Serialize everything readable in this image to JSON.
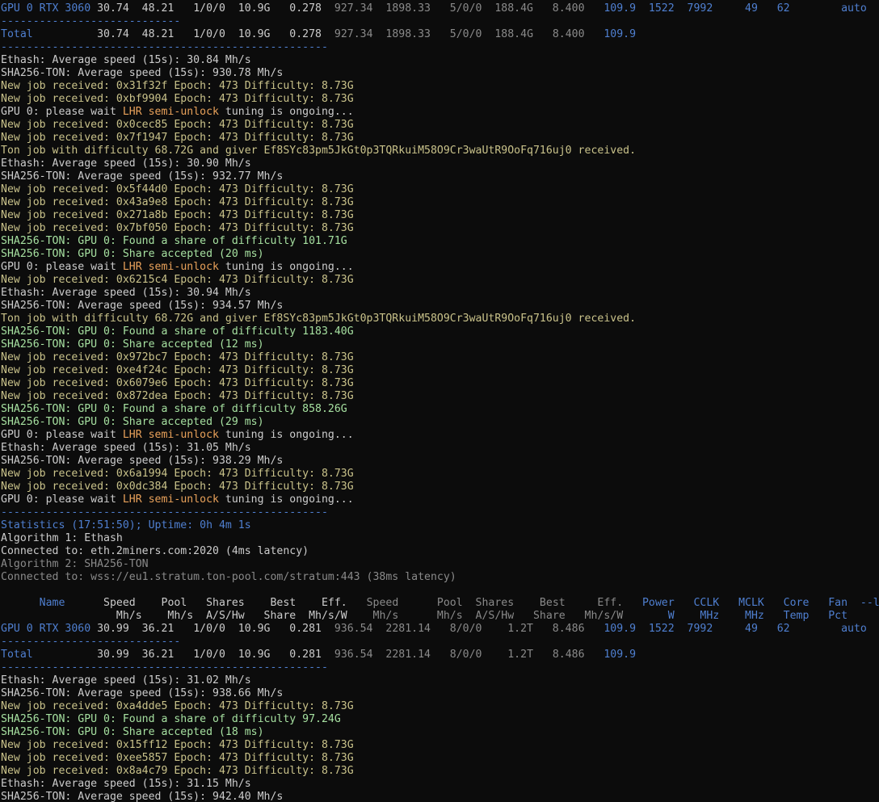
{
  "colors": {
    "background": "#0c0c0c",
    "white": "#cccccc",
    "blue": "#4f7fd0",
    "green": "#a6e0a0",
    "yellow": "#c9c28a",
    "orange": "#e8a15a",
    "gray": "#8a8a8a"
  },
  "lines": [
    [
      [
        "b",
        "GPU 0 RTX 3060"
      ],
      [
        "w",
        " 30.74  48.21   1/0/0  10.9G   0.278 "
      ],
      [
        "gr",
        " 927.34  1898.33   5/0/0  188.4G   8.400 "
      ],
      [
        "b",
        "  109.9  1522  7992     49   62        auto"
      ]
    ],
    [
      [
        "b",
        "----------------------------"
      ]
    ],
    [
      [
        "b",
        "Total"
      ],
      [
        "w",
        "          30.74  48.21   1/0/0  10.9G   0.278 "
      ],
      [
        "gr",
        " 927.34  1898.33   5/0/0  188.4G   8.400 "
      ],
      [
        "b",
        "  109.9"
      ]
    ],
    [
      [
        "b",
        "---------------------------------------------------"
      ]
    ],
    [
      [
        "w",
        "Ethash: Average speed (15s): 30.84 Mh/s"
      ]
    ],
    [
      [
        "w",
        "SHA256-TON: Average speed (15s): 930.78 Mh/s"
      ]
    ],
    [
      [
        "y",
        "New job received: 0x31f32f Epoch: 473 Difficulty: 8.73G"
      ]
    ],
    [
      [
        "y",
        "New job received: 0xbf9904 Epoch: 473 Difficulty: 8.73G"
      ]
    ],
    [
      [
        "w",
        "GPU 0: please wait "
      ],
      [
        "o",
        "LHR semi-unlock"
      ],
      [
        "w",
        " tuning is ongoing..."
      ]
    ],
    [
      [
        "y",
        "New job received: 0x0cec85 Epoch: 473 Difficulty: 8.73G"
      ]
    ],
    [
      [
        "y",
        "New job received: 0x7f1947 Epoch: 473 Difficulty: 8.73G"
      ]
    ],
    [
      [
        "y",
        "Ton job with difficulty 68.72G and giver Ef8SYc83pm5JkGt0p3TQRkuiM58O9Cr3waUtR9OoFq716uj0 received."
      ]
    ],
    [
      [
        "w",
        "Ethash: Average speed (15s): 30.90 Mh/s"
      ]
    ],
    [
      [
        "w",
        "SHA256-TON: Average speed (15s): 932.77 Mh/s"
      ]
    ],
    [
      [
        "y",
        "New job received: 0x5f44d0 Epoch: 473 Difficulty: 8.73G"
      ]
    ],
    [
      [
        "y",
        "New job received: 0x43a9e8 Epoch: 473 Difficulty: 8.73G"
      ]
    ],
    [
      [
        "y",
        "New job received: 0x271a8b Epoch: 473 Difficulty: 8.73G"
      ]
    ],
    [
      [
        "y",
        "New job received: 0x7bf050 Epoch: 473 Difficulty: 8.73G"
      ]
    ],
    [
      [
        "g",
        "SHA256-TON: GPU 0: Found a share of difficulty 101.71G"
      ]
    ],
    [
      [
        "g",
        "SHA256-TON: GPU 0: Share accepted (20 ms)"
      ]
    ],
    [
      [
        "w",
        "GPU 0: please wait "
      ],
      [
        "o",
        "LHR semi-unlock"
      ],
      [
        "w",
        " tuning is ongoing..."
      ]
    ],
    [
      [
        "y",
        "New job received: 0x6215c4 Epoch: 473 Difficulty: 8.73G"
      ]
    ],
    [
      [
        "w",
        "Ethash: Average speed (15s): 30.94 Mh/s"
      ]
    ],
    [
      [
        "w",
        "SHA256-TON: Average speed (15s): 934.57 Mh/s"
      ]
    ],
    [
      [
        "y",
        "Ton job with difficulty 68.72G and giver Ef8SYc83pm5JkGt0p3TQRkuiM58O9Cr3waUtR9OoFq716uj0 received."
      ]
    ],
    [
      [
        "g",
        "SHA256-TON: GPU 0: Found a share of difficulty 1183.40G"
      ]
    ],
    [
      [
        "g",
        "SHA256-TON: GPU 0: Share accepted (12 ms)"
      ]
    ],
    [
      [
        "y",
        "New job received: 0x972bc7 Epoch: 473 Difficulty: 8.73G"
      ]
    ],
    [
      [
        "y",
        "New job received: 0xe4f24c Epoch: 473 Difficulty: 8.73G"
      ]
    ],
    [
      [
        "y",
        "New job received: 0x6079e6 Epoch: 473 Difficulty: 8.73G"
      ]
    ],
    [
      [
        "y",
        "New job received: 0x872dea Epoch: 473 Difficulty: 8.73G"
      ]
    ],
    [
      [
        "g",
        "SHA256-TON: GPU 0: Found a share of difficulty 858.26G"
      ]
    ],
    [
      [
        "g",
        "SHA256-TON: GPU 0: Share accepted (29 ms)"
      ]
    ],
    [
      [
        "w",
        "GPU 0: please wait "
      ],
      [
        "o",
        "LHR semi-unlock"
      ],
      [
        "w",
        " tuning is ongoing..."
      ]
    ],
    [
      [
        "w",
        "Ethash: Average speed (15s): 31.05 Mh/s"
      ]
    ],
    [
      [
        "w",
        "SHA256-TON: Average speed (15s): 938.29 Mh/s"
      ]
    ],
    [
      [
        "y",
        "New job received: 0x6a1994 Epoch: 473 Difficulty: 8.73G"
      ]
    ],
    [
      [
        "y",
        "New job received: 0x0dc384 Epoch: 473 Difficulty: 8.73G"
      ]
    ],
    [
      [
        "w",
        "GPU 0: please wait "
      ],
      [
        "o",
        "LHR semi-unlock"
      ],
      [
        "w",
        " tuning is ongoing..."
      ]
    ],
    [
      [
        "b",
        "---------------------------------------------------"
      ]
    ],
    [
      [
        "b",
        "Statistics (17:51:50); Uptime: 0h 4m 1s"
      ]
    ],
    [
      [
        "w",
        "Algorithm 1: Ethash"
      ]
    ],
    [
      [
        "w",
        "Connected to: eth.2miners.com:2020 (4ms latency)"
      ]
    ],
    [
      [
        "gr",
        "Algorithm 2: SHA256-TON"
      ]
    ],
    [
      [
        "gr",
        "Connected to: wss://eu1.stratum.ton-pool.com/stratum:443 (38ms latency)"
      ]
    ],
    [
      [
        "w",
        ""
      ]
    ],
    [
      [
        "b",
        "      Name"
      ],
      [
        "w",
        "      Speed    Pool   Shares    Best    Eff. "
      ],
      [
        "gr",
        "  Speed      Pool  Shares    Best     Eff. "
      ],
      [
        "b",
        "  Power   CCLK   MCLK   Core   Fan  --lhrtune"
      ]
    ],
    [
      [
        "w",
        "                  Mh/s    Mh/s  A/S/Hw   Share  Mh/s/W "
      ],
      [
        "gr",
        "   Mh/s      Mh/s  A/S/Hw   Share   Mh/s/W "
      ],
      [
        "b",
        "      W    MHz    MHz   Temp   Pct"
      ]
    ],
    [
      [
        "b",
        "GPU 0 RTX 3060"
      ],
      [
        "w",
        " 30.99  36.21   1/0/0  10.9G   0.281 "
      ],
      [
        "gr",
        " 936.54  2281.14   8/0/0    1.2T   8.486 "
      ],
      [
        "b",
        "  109.9  1522  7992     49   62        auto"
      ]
    ],
    [
      [
        "b",
        "----------------------------"
      ]
    ],
    [
      [
        "b",
        "Total"
      ],
      [
        "w",
        "          30.99  36.21   1/0/0  10.9G   0.281 "
      ],
      [
        "gr",
        " 936.54  2281.14   8/0/0    1.2T   8.486 "
      ],
      [
        "b",
        "  109.9"
      ]
    ],
    [
      [
        "b",
        "---------------------------------------------------"
      ]
    ],
    [
      [
        "w",
        "Ethash: Average speed (15s): 31.02 Mh/s"
      ]
    ],
    [
      [
        "w",
        "SHA256-TON: Average speed (15s): 938.66 Mh/s"
      ]
    ],
    [
      [
        "y",
        "New job received: 0xa4dde5 Epoch: 473 Difficulty: 8.73G"
      ]
    ],
    [
      [
        "g",
        "SHA256-TON: GPU 0: Found a share of difficulty 97.24G"
      ]
    ],
    [
      [
        "g",
        "SHA256-TON: GPU 0: Share accepted (18 ms)"
      ]
    ],
    [
      [
        "y",
        "New job received: 0x15ff12 Epoch: 473 Difficulty: 8.73G"
      ]
    ],
    [
      [
        "y",
        "New job received: 0xee5857 Epoch: 473 Difficulty: 8.73G"
      ]
    ],
    [
      [
        "y",
        "New job received: 0x8a4c79 Epoch: 473 Difficulty: 8.73G"
      ]
    ],
    [
      [
        "w",
        "Ethash: Average speed (15s): 31.15 Mh/s"
      ]
    ],
    [
      [
        "w",
        "SHA256-TON: Average speed (15s): 942.40 Mh/s"
      ]
    ]
  ]
}
